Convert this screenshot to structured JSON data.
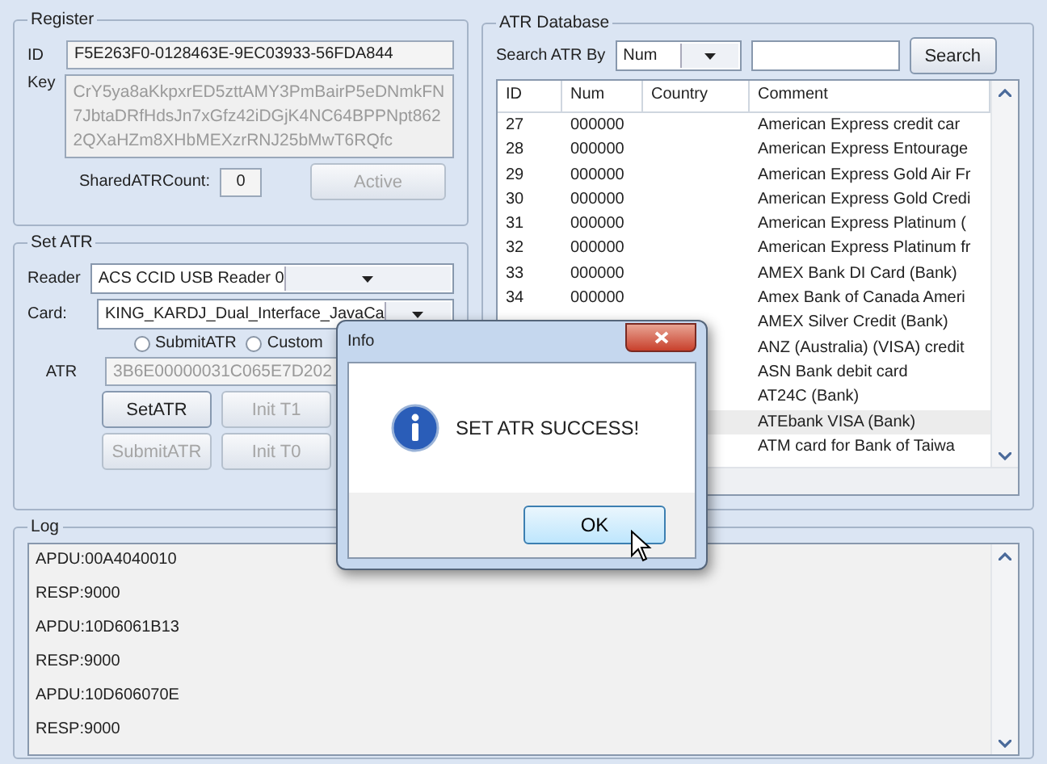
{
  "register": {
    "title": "Register",
    "id_label": "ID",
    "id_value": "F5E263F0-0128463E-9EC03933-56FDA844",
    "key_label": "Key",
    "key_value": "CrY5ya8aKkpxrED5zttAMY3PmBairP5eDNmkFN7JbtaDRfHdsJn7xGfz42iDGjK4NC64BPPNpt8622QXaHZm8XHbMEXzrRNJ25bMwT6RQfc",
    "count_label": "SharedATRCount:",
    "count_value": "0",
    "active_button": {
      "label": "Active",
      "disabled": true
    }
  },
  "set_atr": {
    "title": "Set ATR",
    "reader_label": "Reader",
    "reader_value": "ACS CCID USB Reader 0",
    "card_label": "Card:",
    "card_value": "KING_KARDJ_Dual_Interface_JavaCa",
    "radios": [
      {
        "label": "SubmitATR",
        "selected": false
      },
      {
        "label": "Custom",
        "selected": false
      }
    ],
    "atr_label": "ATR",
    "atr_value": "3B6E00000031C065E7D202",
    "buttons": [
      {
        "label": "SetATR",
        "disabled": false
      },
      {
        "label": "Init T1",
        "disabled": true
      },
      {
        "label": "SubmitATR",
        "disabled": true
      },
      {
        "label": "Init T0",
        "disabled": true
      }
    ]
  },
  "atr_database": {
    "title": "ATR Database",
    "search_label": "Search ATR By",
    "search_by": "Num",
    "search_button": "Search",
    "columns": [
      "ID",
      "Num",
      "Country",
      "Comment"
    ],
    "rows": [
      {
        "id": "27",
        "num": "000000",
        "comment": "American Express credit car",
        "selected": false
      },
      {
        "id": "28",
        "num": "000000",
        "comment": "American Express Entourage",
        "selected": false
      },
      {
        "id": "29",
        "num": "000000",
        "comment": "American Express Gold Air Fr",
        "selected": false
      },
      {
        "id": "30",
        "num": "000000",
        "comment": "American Express Gold Credi",
        "selected": false
      },
      {
        "id": "31",
        "num": "000000",
        "comment": "American Express Platinum (",
        "selected": false
      },
      {
        "id": "32",
        "num": "000000",
        "comment": "American Express Platinum fr",
        "selected": false
      },
      {
        "id": "33",
        "num": "000000",
        "comment": "AMEX Bank DI Card (Bank)",
        "selected": false
      },
      {
        "id": "34",
        "num": "000000",
        "comment": "Amex Bank of Canada Ameri",
        "selected": false
      },
      {
        "comment": "AMEX Silver Credit (Bank)",
        "selected": false
      },
      {
        "comment": "ANZ (Australia) (VISA) credit",
        "selected": false
      },
      {
        "comment": "ASN Bank debit card",
        "selected": false
      },
      {
        "comment": "AT24C (Bank)",
        "selected": false
      },
      {
        "comment": "ATEbank VISA (Bank)",
        "selected": true
      },
      {
        "comment": "ATM card for Bank of Taiwa",
        "selected": false
      }
    ]
  },
  "log": {
    "title": "Log",
    "lines": [
      "APDU:00A4040010",
      "RESP:9000",
      "APDU:10D6061B13",
      "RESP:9000",
      "APDU:10D606070E",
      "RESP:9000"
    ]
  },
  "dialog": {
    "title": "Info",
    "message": "SET ATR SUCCESS!",
    "button": "OK"
  }
}
